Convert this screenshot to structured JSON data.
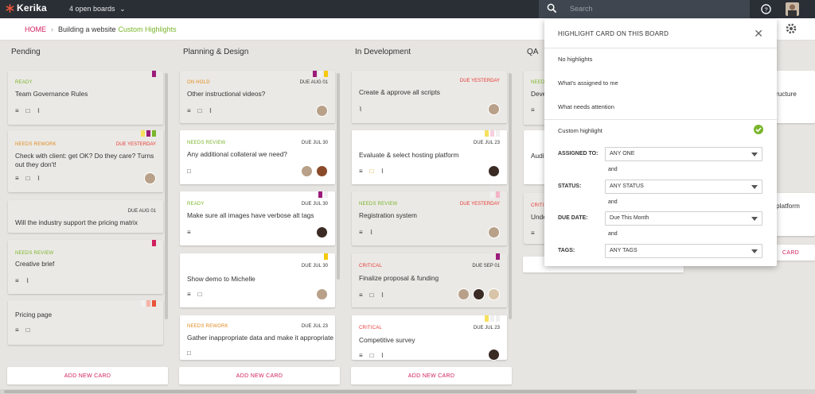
{
  "app": {
    "name": "Kerika",
    "boards_label": "4 open boards"
  },
  "search": {
    "placeholder": "Search"
  },
  "breadcrumb": {
    "home": "HOME",
    "board": "Building a website",
    "highlight": "Custom Highlights"
  },
  "columns": [
    {
      "title": "Pending",
      "add_label": "ADD NEW CARD"
    },
    {
      "title": "Planning & Design",
      "add_label": "ADD NEW CARD"
    },
    {
      "title": "In Development",
      "add_label": "ADD NEW CARD"
    },
    {
      "title": "QA",
      "add_label": "ADD NEW CARD"
    }
  ],
  "pending": [
    {
      "status": "READY",
      "title": "Team Governance Rules"
    },
    {
      "status": "NEEDS REWORK",
      "due": "DUE YESTERDAY",
      "title1": "Check with client: get OK? Do they care?  Turns",
      "title2": "out they don't!"
    },
    {
      "due": "DUE AUG 01",
      "title": "Will the industry support the pricing matrix"
    },
    {
      "status": "NEEDS REVIEW",
      "title": "Creative brief"
    },
    {
      "title": "Pricing page"
    }
  ],
  "planning": [
    {
      "status": "ON HOLD",
      "due": "DUE AUG 01",
      "title": "Other instructional videos?"
    },
    {
      "status": "NEEDS REVIEW",
      "due": "DUE JUL 30",
      "title": "Any additional collateral we need?"
    },
    {
      "status": "READY",
      "due": "DUE JUL 30",
      "title": "Make sure all images have verbose alt tags"
    },
    {
      "due": "DUE JUL 30",
      "title": "Show demo to Michelle"
    },
    {
      "status": "NEEDS REWORK",
      "due": "DUE JUL 23",
      "title": "Gather inappropriate data and make it appropriate"
    }
  ],
  "development": [
    {
      "due": "DUE YESTERDAY",
      "title": "Create & approve all scripts"
    },
    {
      "due": "DUE JUL 23",
      "title": "Evaluate & select hosting platform"
    },
    {
      "status": "NEEDS REVIEW",
      "due": "DUE YESTERDAY",
      "title": "Registration system"
    },
    {
      "status": "CRITICAL",
      "due": "DUE SEP 01",
      "title": "Finalize proposal & funding"
    },
    {
      "status": "CRITICAL",
      "due": "DUE JUL 23",
      "title": "Competitive survey"
    }
  ],
  "qa_partial": {
    "needs_re": "NEEDS RE",
    "deve": "Deve",
    "audit": "Audit",
    "critic": "CRITIC",
    "unde": "Unde",
    "ructure": "ructure",
    "platform": "platform",
    "add_new_card_fragment": "ADD NEW CARD",
    "card_fragment": "CARD"
  },
  "panel": {
    "title": "HIGHLIGHT CARD ON THIS BOARD",
    "options": [
      "No highlights",
      "What's assigned to me",
      "What needs attention",
      "Custom highlight"
    ],
    "assigned_label": "ASSIGNED TO:",
    "assigned_value": "ANY ONE",
    "and": "and",
    "status_label": "STATUS:",
    "status_value": "ANY STATUS",
    "due_label": "DUE DATE:",
    "due_value": "Due This Month",
    "tags_label": "TAGS:",
    "tags_value": "ANY TAGS"
  },
  "colors": {
    "accent": "#d11f5f",
    "ready": "#7ab52b",
    "needs_review": "#7ab52b",
    "needs_rework": "#e08a1e",
    "on_hold": "#e08a1e",
    "critical": "#e53935",
    "due_red": "#e53935"
  }
}
